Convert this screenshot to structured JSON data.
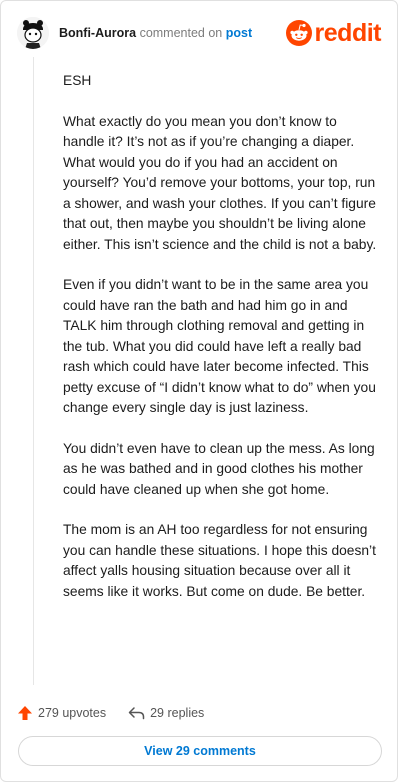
{
  "comment": {
    "author": "Bonfi-Aurora",
    "action_text": "commented on",
    "post_link": "post",
    "paragraphs": [
      "ESH",
      "What exactly do you mean you don’t know to handle it? It’s not as if you’re changing a diaper. What would you do if you had an accident on yourself? You’d remove your bottoms, your top, run a shower, and wash your clothes. If you can’t figure that out, then maybe you shouldn’t be living alone either. This isn’t science and the child is not a baby.",
      "Even if you didn’t want to be in the same area you could have ran the bath and had him go in and TALK him through clothing removal and getting in the tub. What you did could have left a really bad rash which could have later become infected. This petty excuse of “I didn’t know what to do” when you change every single day is just laziness.",
      "You didn’t even have to clean up the mess. As long as he was bathed and in good clothes his mother could have cleaned up when she got home.",
      "The mom is an AH too regardless for not ensuring you can handle these situations. I hope this doesn’t affect yalls housing situation because over all it seems like it works. But come on dude. Be better."
    ]
  },
  "brand": {
    "name": "reddit",
    "color": "#ff4500",
    "icon": "reddit-snoo-icon"
  },
  "footer": {
    "upvotes": "279 upvotes",
    "replies": "29 replies",
    "upvote_icon": "upvote-arrow-icon",
    "reply_icon": "reply-arrow-icon"
  },
  "view_button": {
    "label": "View 29 comments",
    "color": "#0079d3"
  }
}
